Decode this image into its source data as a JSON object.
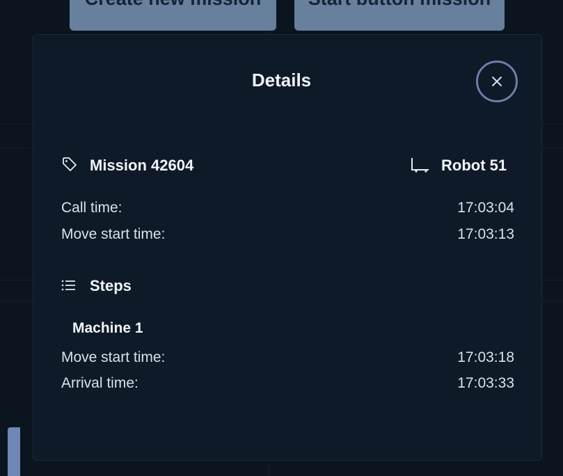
{
  "background": {
    "buttons": [
      {
        "label": "Create new mission"
      },
      {
        "label": "Start button mission"
      }
    ]
  },
  "modal": {
    "title": "Details",
    "close_icon": "close-icon",
    "mission": {
      "label": "Mission 42604",
      "icon": "tag-icon"
    },
    "robot": {
      "label": "Robot 51",
      "icon": "robot-cart-icon"
    },
    "times": [
      {
        "label": "Call time:",
        "value": "17:03:04"
      },
      {
        "label": "Move start time:",
        "value": "17:03:13"
      }
    ],
    "steps": {
      "heading": "Steps",
      "icon": "list-icon",
      "items": [
        {
          "name": "Machine 1",
          "times": [
            {
              "label": "Move start time:",
              "value": "17:03:18"
            },
            {
              "label": "Arrival time:",
              "value": "17:03:33"
            }
          ]
        }
      ]
    }
  },
  "colors": {
    "modal_background": "#0e1a28",
    "page_background": "#0a1520",
    "button_background": "#6f8aa8",
    "close_ring": "#6d7ea6"
  }
}
